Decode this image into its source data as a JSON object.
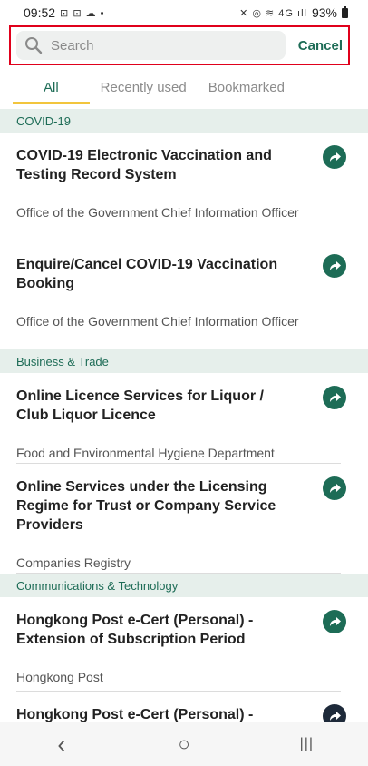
{
  "status_bar": {
    "time": "09:52",
    "left_icons": "⊡ ⊡ ☁ •",
    "right_icons": "✕ ◎ ≋ 4G ıll",
    "battery": "93%"
  },
  "search": {
    "placeholder": "Search",
    "value": "",
    "cancel_label": "Cancel"
  },
  "tabs": [
    {
      "label": "All",
      "active": true
    },
    {
      "label": "Recently used",
      "active": false
    },
    {
      "label": "Bookmarked",
      "active": false
    }
  ],
  "sections": [
    {
      "header": "COVID-19",
      "items": [
        {
          "title": "COVID-19 Electronic Vaccination and Testing Record System",
          "dept": "Office of the Government Chief Information Officer"
        },
        {
          "title": "Enquire/Cancel COVID-19 Vaccination Booking",
          "dept": "Office of the Government Chief Information Officer"
        }
      ]
    },
    {
      "header": "Business & Trade",
      "items": [
        {
          "title": "Online Licence Services for Liquor / Club Liquor Licence",
          "dept": "Food and Environmental Hygiene Department"
        },
        {
          "title": "Online Services under the Licensing Regime for Trust or Company Service Providers",
          "dept": "Companies Registry"
        }
      ]
    },
    {
      "header": "Communications & Technology",
      "items": [
        {
          "title": "Hongkong Post e-Cert (Personal) - Extension of Subscription Period",
          "dept": "Hongkong Post"
        },
        {
          "title": "Hongkong Post e-Cert (Personal) -",
          "dept": ""
        }
      ]
    }
  ],
  "nav_bar": {
    "back": "‹",
    "home": "○",
    "recents": "|||"
  },
  "colors": {
    "accent": "#1d6c56",
    "tab_indicator": "#f2c53d",
    "section_bg": "#e6efeb",
    "highlight_border": "#e0001b"
  }
}
